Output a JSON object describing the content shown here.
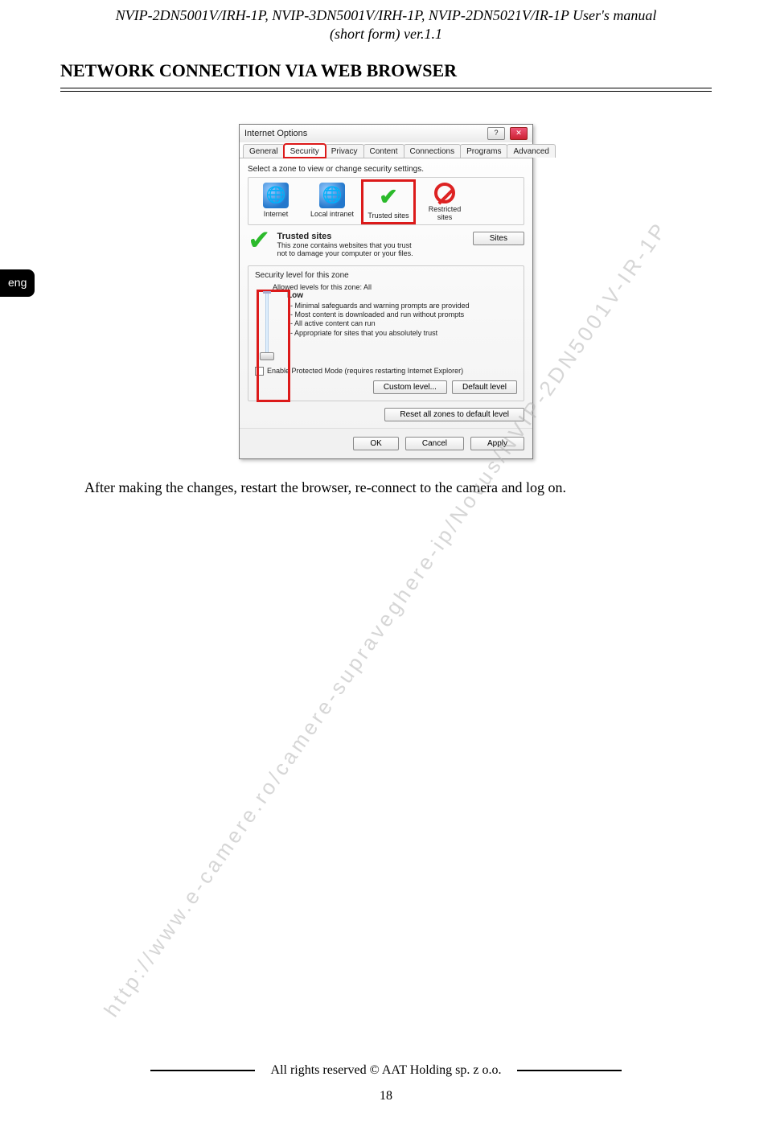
{
  "header": {
    "line1": "NVIP-2DN5001V/IRH-1P, NVIP-3DN5001V/IRH-1P, NVIP-2DN5021V/IR-1P User's manual",
    "line2": "(short form) ver.1.1"
  },
  "section_title": "NETWORK CONNECTION VIA WEB BROWSER",
  "lang_tab": "eng",
  "dialog": {
    "title": "Internet Options",
    "help_label": "?",
    "close_label": "✕",
    "tabs": [
      "General",
      "Security",
      "Privacy",
      "Content",
      "Connections",
      "Programs",
      "Advanced"
    ],
    "active_tab_index": 1,
    "select_zone_text": "Select a zone to view or change security settings.",
    "zones": {
      "internet": "Internet",
      "intranet": "Local intranet",
      "trusted": "Trusted sites",
      "restricted": "Restricted sites"
    },
    "trusted_block": {
      "title": "Trusted sites",
      "desc": "This zone contains websites that you trust not to damage your computer or your files.",
      "sites_btn": "Sites"
    },
    "security_group": {
      "legend": "Security level for this zone",
      "allowed": "Allowed levels for this zone: All",
      "level_name": "Low",
      "bullets": [
        "Minimal safeguards and warning prompts are provided",
        "Most content is downloaded and run without prompts",
        "All active content can run",
        "Appropriate for sites that you absolutely trust"
      ],
      "protected_mode": "Enable Protected Mode (requires restarting Internet Explorer)",
      "custom_btn": "Custom level...",
      "default_btn": "Default level",
      "reset_btn": "Reset all zones to default level"
    },
    "footer": {
      "ok": "OK",
      "cancel": "Cancel",
      "apply": "Apply"
    }
  },
  "instruction_text": "After making the changes, restart the browser, re-connect to the camera and log on.",
  "watermark": "http://www.e-camere.ro/camere-supraveghere-ip/Novus/NVIP-2DN5001V-IR-1P",
  "footer": {
    "rights": "All rights reserved © AAT Holding sp. z o.o.",
    "page": "18"
  }
}
